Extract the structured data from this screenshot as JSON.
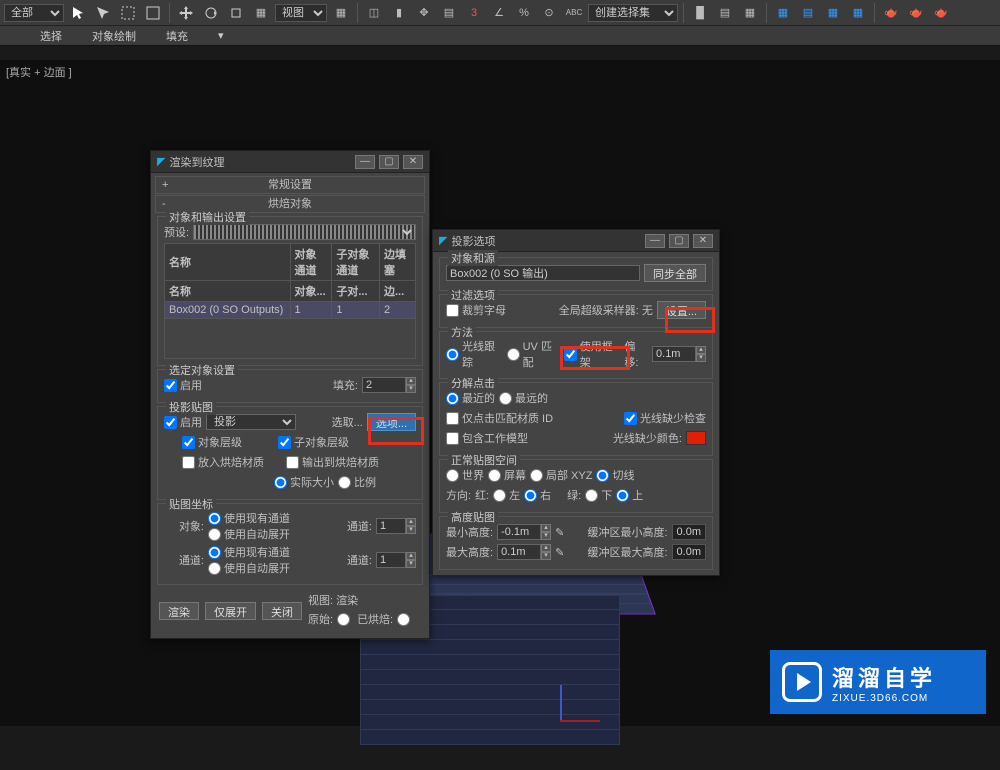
{
  "toolbar": {
    "dropdown1": "全部",
    "dropdown2": "视图",
    "dropdown3": "创建选择集"
  },
  "menu": {
    "select": "选择",
    "objpaint": "对象绘制",
    "fill": "填充"
  },
  "viewport_label": "[真实 + 边面 ]",
  "dialog1": {
    "title": "渲染到纹理",
    "accordion1": "常规设置",
    "accordion2": "烘焙对象",
    "grp_objects": "对象和输出设置",
    "preset": "预设:",
    "tbl": {
      "h1": "名称",
      "h2": "对象通道",
      "h3": "子对象通道",
      "h4": "边填塞",
      "r_h1": "名称",
      "r_h2": "对象...",
      "r_h3": "子对...",
      "r_h4": "边...",
      "row_name": "Box002 (0 SO Outputs)",
      "row_c1": "1",
      "row_c2": "1",
      "row_c3": "2"
    },
    "grp_sel": "选定对象设置",
    "enable": "启用",
    "fill": "填充:",
    "fill_val": "2",
    "grp_proj": "投影贴图",
    "proj_sel": "投影",
    "pick": "选取...",
    "options": "选项...",
    "obj_level": "对象层级",
    "subobj_level": "子对象层级",
    "put_bake": "放入烘焙材质",
    "out_bake": "输出到烘焙材质",
    "actual": "实际大小",
    "ratio": "比例",
    "grp_map": "贴图坐标",
    "object": "对象:",
    "use_existing": "使用现有通道",
    "use_auto": "使用自动展开",
    "channel": "通道:",
    "chan_val": "1",
    "channel2": "通道:",
    "render": "渲染",
    "unwrap": "仅展开",
    "close": "关闭",
    "viewport_render": "视图: 渲染",
    "original": "原始:",
    "baked": "已烘焙:"
  },
  "dialog2": {
    "title": "投影选项 ",
    "grp_src": "对象和源",
    "src_val": "Box002 (0 SO 输出)",
    "sync_all": "同步全部",
    "grp_filter": "过滤选项",
    "crop": "裁剪字母",
    "global_ss": "全局超级采样器: 无",
    "setup": "设置...",
    "grp_method": "方法",
    "ray": "光线跟踪",
    "uvmatch": "UV 匹配",
    "use_cage": "使用框架",
    "offset": "偏移:",
    "offset_val": "0.1m",
    "grp_hit": "分解点击",
    "nearest": "最近的",
    "farthest": "最远的",
    "only_match": "仅点击匹配材质 ID",
    "ray_miss_check": "光线缺少检查",
    "include_work": "包含工作模型",
    "ray_miss_color": "光线缺少颜色:",
    "grp_normal": "正常贴图空间",
    "world": "世界",
    "screen": "屏幕",
    "local": "局部 XYZ",
    "tangent": "切线",
    "direction": "方向:",
    "red": "红:",
    "left": "左",
    "right": "右",
    "green": "绿:",
    "down": "下",
    "up": "上",
    "grp_height": "高度贴图",
    "min_h": "最小高度:",
    "min_val": "-0.1m",
    "buf_min": "缓冲区最小高度:",
    "buf_min_val": "0.0m",
    "max_h": "最大高度:",
    "max_val": "0.1m",
    "buf_max": "缓冲区最大高度:",
    "buf_max_val": "0.0m"
  },
  "watermark": {
    "cn": "溜溜自学",
    "en": "ZIXUE.3D66.COM"
  }
}
